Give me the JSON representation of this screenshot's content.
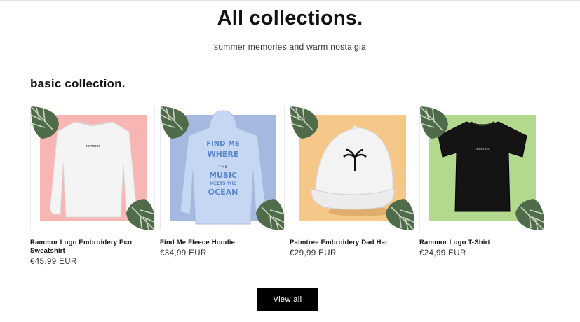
{
  "header": {
    "title": "All collections.",
    "subtitle": "summer memories and warm nostalgia"
  },
  "section": {
    "heading": "basic collection."
  },
  "products": [
    {
      "title": "Rammor Logo Embroidery Eco Sweatshirt",
      "price": "€45,99 EUR",
      "backdrop_color": "#f7b6b4",
      "item_color": "#f4f4f4",
      "print_text": "rammor."
    },
    {
      "title": "Find Me Fleece Hoodie",
      "price": "€34,99 EUR",
      "backdrop_color": "#a4b8e0",
      "item_color": "#c6d7f3",
      "print_text": "FIND ME WHERE THE MUSIC MEETS THE OCEAN"
    },
    {
      "title": "Palmtree Embroidery Dad Hat",
      "price": "€29,99 EUR",
      "backdrop_color": "#f5c889",
      "item_color": "#f3f3f3",
      "print_text": ""
    },
    {
      "title": "Rammor Logo T-Shirt",
      "price": "€24,99 EUR",
      "backdrop_color": "#b3d98f",
      "item_color": "#141414",
      "print_text": "rammor."
    }
  ],
  "actions": {
    "view_all_label": "View all"
  },
  "icons": {
    "leaf": "monstera-leaf-icon"
  }
}
